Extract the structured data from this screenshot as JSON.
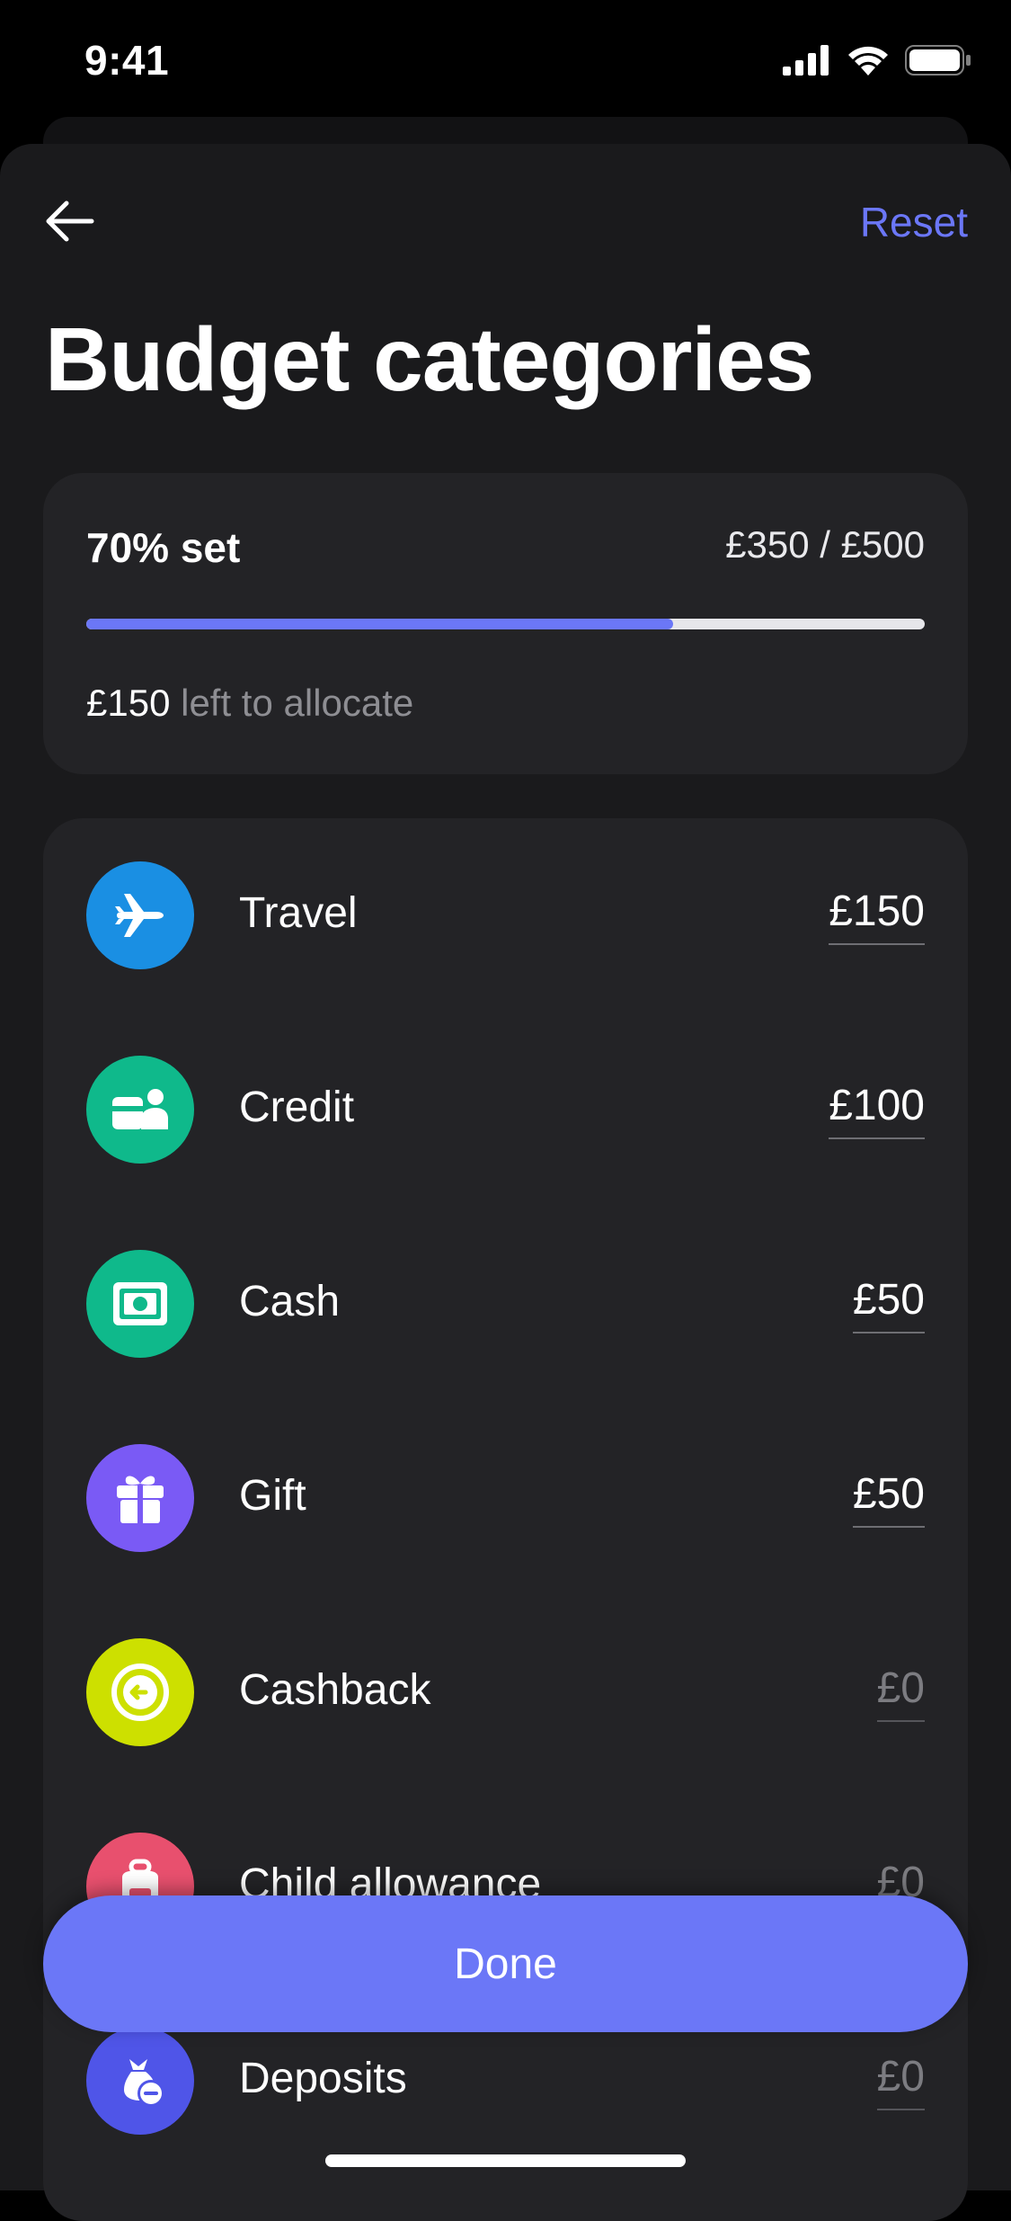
{
  "status_bar": {
    "time": "9:41",
    "icons": [
      "cellular-signal-icon",
      "wifi-icon",
      "battery-icon"
    ]
  },
  "header": {
    "back_icon": "arrow-left-icon",
    "reset_label": "Reset",
    "title": "Budget categories"
  },
  "summary": {
    "percent_label": "70% set",
    "amounts": "£350 / £500",
    "progress": 0.7,
    "left_amount": "£150",
    "left_label": " left to allocate"
  },
  "categories": [
    {
      "name": "Travel",
      "amount": "£150",
      "icon": "airplane-icon",
      "color": "#1a8fe3",
      "is_set": true
    },
    {
      "name": "Credit",
      "amount": "£100",
      "icon": "credit-icon",
      "color": "#0fb98b",
      "is_set": true
    },
    {
      "name": "Cash",
      "amount": "£50",
      "icon": "banknote-icon",
      "color": "#0fb98b",
      "is_set": true
    },
    {
      "name": "Gift",
      "amount": "£50",
      "icon": "gift-icon",
      "color": "#7a5af5",
      "is_set": true
    },
    {
      "name": "Cashback",
      "amount": "£0",
      "icon": "cashback-icon",
      "color": "#cde000",
      "is_set": false
    },
    {
      "name": "Child allowance",
      "amount": "£0",
      "icon": "child-allowance-icon",
      "color": "#e8506e",
      "is_set": false
    },
    {
      "name": "Deposits",
      "amount": "£0",
      "icon": "deposits-icon",
      "color": "#4f55e8",
      "is_set": false
    }
  ],
  "done_label": "Done",
  "colors": {
    "accent": "#6b77f7",
    "background": "#1a1a1c",
    "card": "#232326",
    "muted_text": "#8e8e93"
  }
}
